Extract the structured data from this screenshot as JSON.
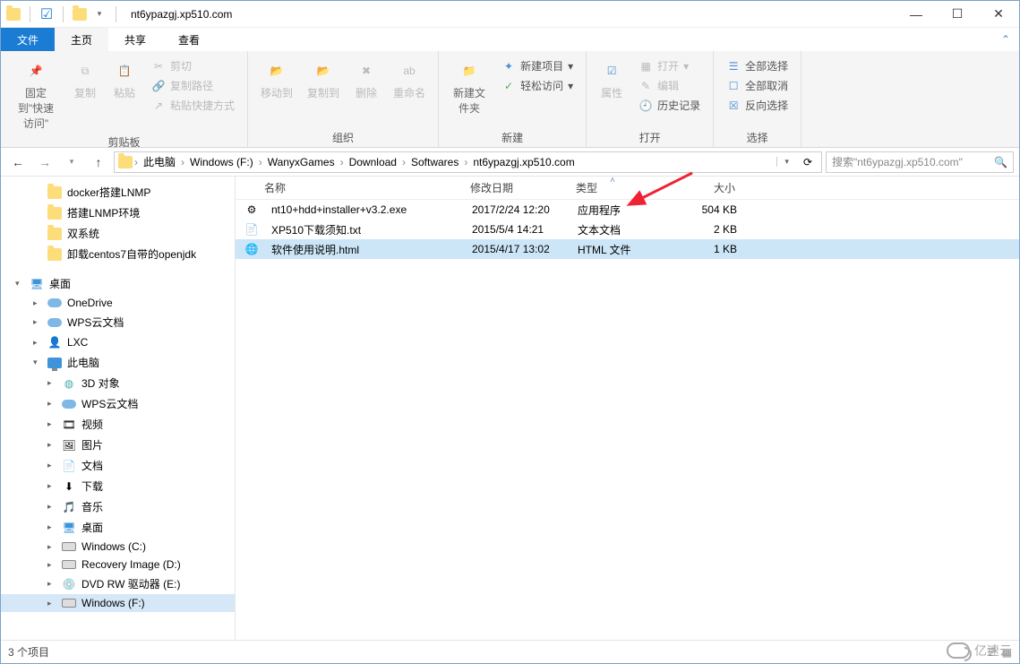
{
  "titlebar": {
    "title": "nt6ypazgj.xp510.com"
  },
  "tabs": {
    "file": "文件",
    "home": "主页",
    "share": "共享",
    "view": "查看"
  },
  "ribbon": {
    "pin": "固定到\"快速访问\"",
    "copy": "复制",
    "paste": "粘贴",
    "copy_path": "复制路径",
    "paste_shortcut": "粘贴快捷方式",
    "cut": "剪切",
    "clip_group": "剪贴板",
    "move_to": "移动到",
    "copy_to": "复制到",
    "delete": "删除",
    "rename": "重命名",
    "org_group": "组织",
    "new_folder": "新建文件夹",
    "new_item": "新建项目",
    "easy_access": "轻松访问",
    "new_group": "新建",
    "props": "属性",
    "open": "打开",
    "edit": "编辑",
    "history": "历史记录",
    "open_group": "打开",
    "select_all": "全部选择",
    "select_none": "全部取消",
    "invert": "反向选择",
    "select_group": "选择"
  },
  "breadcrumb": {
    "root": "此电脑",
    "items": [
      "Windows (F:)",
      "WanyxGames",
      "Download",
      "Softwares",
      "nt6ypazgj.xp510.com"
    ]
  },
  "search": {
    "placeholder": "搜索\"nt6ypazgj.xp510.com\""
  },
  "nav": {
    "quick": [
      {
        "label": "docker搭建LNMP"
      },
      {
        "label": "搭建LNMP环境"
      },
      {
        "label": "双系统"
      },
      {
        "label": "卸载centos7自带的openjdk"
      }
    ],
    "desktop": "桌面",
    "tree": [
      {
        "label": "OneDrive",
        "icon": "cloud"
      },
      {
        "label": "WPS云文档",
        "icon": "cloud"
      },
      {
        "label": "LXC",
        "icon": "user"
      },
      {
        "label": "此电脑",
        "icon": "pc",
        "expanded": true,
        "children": [
          {
            "label": "3D 对象",
            "icon": "obj"
          },
          {
            "label": "WPS云文档",
            "icon": "cloud"
          },
          {
            "label": "视频",
            "icon": "video"
          },
          {
            "label": "图片",
            "icon": "pic"
          },
          {
            "label": "文档",
            "icon": "doc"
          },
          {
            "label": "下载",
            "icon": "dl"
          },
          {
            "label": "音乐",
            "icon": "music"
          },
          {
            "label": "桌面",
            "icon": "desk"
          },
          {
            "label": "Windows (C:)",
            "icon": "disk"
          },
          {
            "label": "Recovery Image (D:)",
            "icon": "disk"
          },
          {
            "label": "DVD RW 驱动器 (E:)",
            "icon": "dvd"
          },
          {
            "label": "Windows (F:)",
            "icon": "disk",
            "selected": true
          }
        ]
      }
    ]
  },
  "columns": {
    "name": "名称",
    "date": "修改日期",
    "type": "类型",
    "size": "大小"
  },
  "files": [
    {
      "name": "nt10+hdd+installer+v3.2.exe",
      "date": "2017/2/24 12:20",
      "type": "应用程序",
      "size": "504 KB",
      "icon": "exe"
    },
    {
      "name": "XP510下载须知.txt",
      "date": "2015/5/4 14:21",
      "type": "文本文档",
      "size": "2 KB",
      "icon": "txt"
    },
    {
      "name": "软件使用说明.html",
      "date": "2015/4/17 13:02",
      "type": "HTML 文件",
      "size": "1 KB",
      "icon": "html",
      "selected": true
    }
  ],
  "status": {
    "count": "3 个项目"
  },
  "watermark": "亿速云"
}
